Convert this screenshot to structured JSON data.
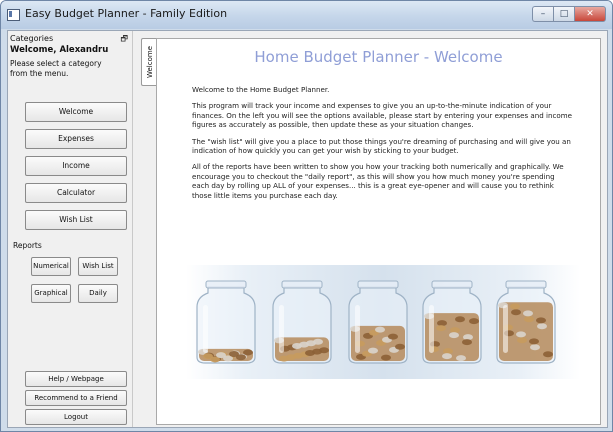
{
  "window": {
    "title": "Easy Budget Planner - Family Edition",
    "controls": {
      "minimize": "–",
      "maximize": "□",
      "close": "✕"
    }
  },
  "sidebar": {
    "header": "Categories",
    "pin_icon": "pin-icon",
    "welcome": "Welcome, Alexandru",
    "select_message": "Please select a category from the menu.",
    "nav": [
      "Welcome",
      "Expenses",
      "Income",
      "Calculator",
      "Wish List"
    ],
    "reports_label": "Reports",
    "reports": [
      "Numerical",
      "Wish List",
      "Graphical",
      "Daily"
    ],
    "bottom": [
      "Help / Webpage",
      "Recommend to a Friend",
      "Logout"
    ]
  },
  "tab": {
    "label": "Welcome"
  },
  "main": {
    "title": "Home Budget Planner - Welcome",
    "paragraphs": [
      "Welcome to the Home Budget Planner.",
      "This program will track your income and expenses to give you an up-to-the-minute indication of your finances. On the left you will see the options available, please start by entering your expenses and income figures as accurately as possible, then update these as your situation changes.",
      "The \"wish list\" will give you a place to put those things you're dreaming of purchasing and will give you an indication of how quickly you can get your wish by sticking to your budget.",
      "All of the reports have been written to show you how your tracking both numerically and graphically. We encourage you to checkout the \"daily report\", as this will show you how much money you're spending each day by rolling up ALL of your expenses... this is a great eye-opener and will cause you to rethink those little items you purchase each day."
    ],
    "image": {
      "name": "coin-jars-image",
      "coin_fill_levels": [
        0.22,
        0.4,
        0.58,
        0.78,
        0.95
      ]
    }
  },
  "colors": {
    "title_blue": "#8f9ed6",
    "chrome": "#cfdcea",
    "coin": "#b58a5a"
  }
}
